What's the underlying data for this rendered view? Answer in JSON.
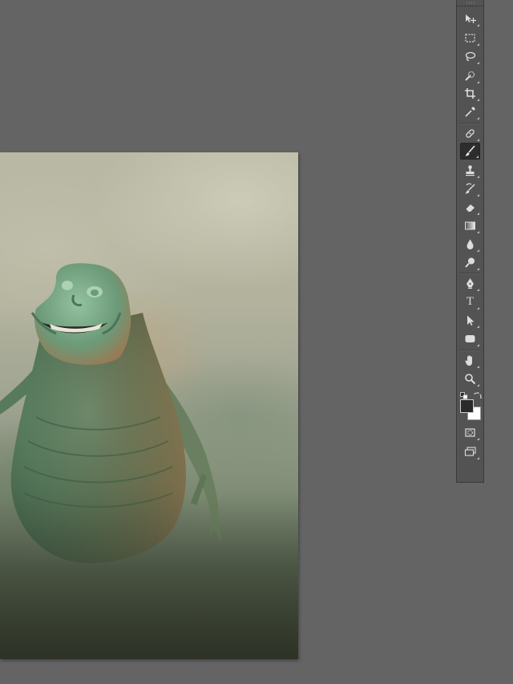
{
  "workspace": {
    "background_color": "#646464"
  },
  "document": {
    "image_description_alt": "",
    "colors": {
      "sky": "#b4b39e",
      "fog_dark": "#34392c",
      "creature": "#5e8a6a"
    }
  },
  "toolbox": {
    "tools": [
      {
        "id": "move",
        "icon": "move-icon"
      },
      {
        "id": "marquee",
        "icon": "rect-marquee-icon"
      },
      {
        "id": "lasso",
        "icon": "lasso-icon"
      },
      {
        "id": "quick-select",
        "icon": "quick-select-icon"
      },
      {
        "id": "crop",
        "icon": "crop-icon"
      },
      {
        "id": "eyedropper",
        "icon": "eyedropper-icon"
      },
      {
        "id": "healing",
        "icon": "spot-healing-icon"
      },
      {
        "id": "brush",
        "icon": "brush-icon",
        "active": true
      },
      {
        "id": "stamp",
        "icon": "clone-stamp-icon"
      },
      {
        "id": "history-brush",
        "icon": "history-brush-icon"
      },
      {
        "id": "eraser",
        "icon": "eraser-icon"
      },
      {
        "id": "gradient",
        "icon": "gradient-icon"
      },
      {
        "id": "blur",
        "icon": "blur-icon"
      },
      {
        "id": "dodge",
        "icon": "dodge-icon"
      },
      {
        "id": "pen",
        "icon": "pen-icon"
      },
      {
        "id": "type",
        "icon": "type-icon",
        "glyph": "T"
      },
      {
        "id": "path-select",
        "icon": "path-selection-icon"
      },
      {
        "id": "shape",
        "icon": "rounded-rect-icon"
      },
      {
        "id": "hand",
        "icon": "hand-icon"
      },
      {
        "id": "zoom",
        "icon": "zoom-icon"
      },
      {
        "id": "quick-mask",
        "icon": "quick-mask-icon"
      },
      {
        "id": "screen-mode",
        "icon": "screen-mode-icon"
      }
    ],
    "foreground_color": "#2a2a2a",
    "background_color": "#ffffff"
  }
}
